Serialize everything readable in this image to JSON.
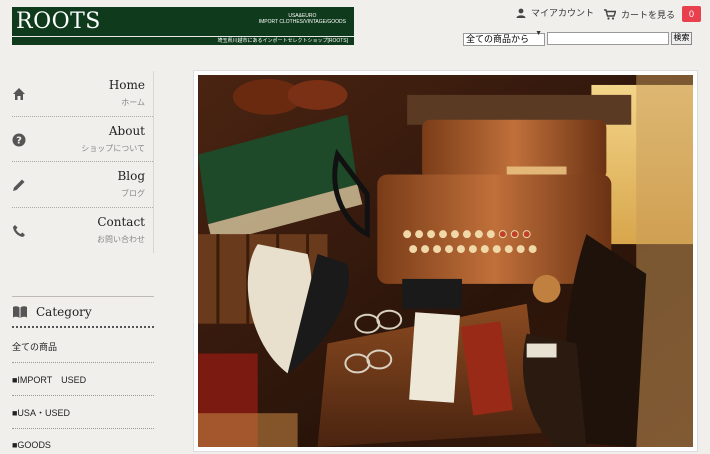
{
  "logo": {
    "title": "ROOTS",
    "subline1": "USA&EURO",
    "subline2": "IMPORT CLOTHES/VINTAGE/GOODS",
    "tagline": "埼玉県川越市にあるインポートセレクトショップ[ROOTS]"
  },
  "header": {
    "account_label": "マイアカウント",
    "cart_label": "カートを見る",
    "cart_count": "0"
  },
  "search": {
    "select_value": "全ての商品から",
    "query": "",
    "button_label": "検索"
  },
  "nav": [
    {
      "en": "Home",
      "jp": "ホーム",
      "icon": "home-icon"
    },
    {
      "en": "About",
      "jp": "ショップについて",
      "icon": "question-icon"
    },
    {
      "en": "Blog",
      "jp": "ブログ",
      "icon": "pencil-icon"
    },
    {
      "en": "Contact",
      "jp": "お問い合わせ",
      "icon": "phone-icon"
    }
  ],
  "category": {
    "heading": "Category",
    "items": [
      "全ての商品",
      "■IMPORT　USED",
      "■USA・USED",
      "■GOODS"
    ]
  },
  "colors": {
    "logo_bg": "#0f3a1c",
    "badge": "#e8404c",
    "background": "#f1efec"
  }
}
